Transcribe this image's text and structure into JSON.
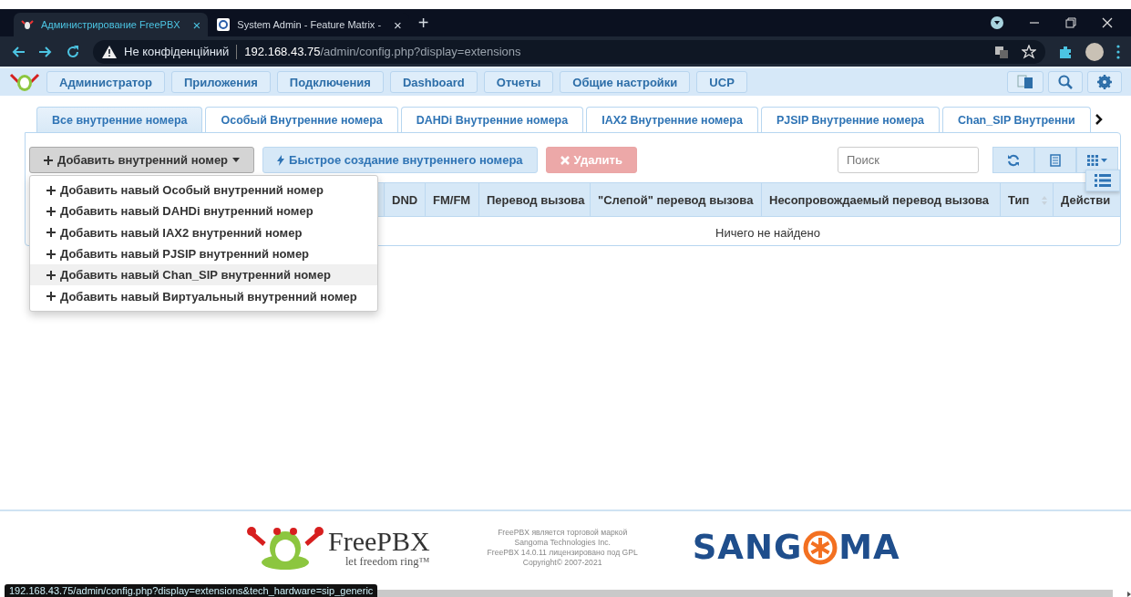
{
  "browser": {
    "tabs": [
      {
        "title": "Администрирование FreePBX",
        "selected": true,
        "close": "×"
      },
      {
        "title": "System Admin - Feature Matrix -",
        "selected": false,
        "close": "×"
      }
    ],
    "new_tab": "+",
    "address": {
      "warning": "Не конфіденційний",
      "host": "192.168.43.75",
      "path": "/admin/config.php?display=extensions"
    }
  },
  "nav": {
    "items": [
      {
        "label": "Администратор"
      },
      {
        "label": "Приложения"
      },
      {
        "label": "Подключения"
      },
      {
        "label": "Dashboard"
      },
      {
        "label": "Отчеты"
      },
      {
        "label": "Общие настройки"
      },
      {
        "label": "UCP"
      }
    ]
  },
  "extension_tabs": [
    {
      "label": "Все внутренние номера",
      "selected": true
    },
    {
      "label": "Особый Внутренние номера",
      "selected": false
    },
    {
      "label": "DAHDi Внутренние номера",
      "selected": false
    },
    {
      "label": "IAX2 Внутренние номера",
      "selected": false
    },
    {
      "label": "PJSIP Внутренние номера",
      "selected": false
    },
    {
      "label": "Chan_SIP Внутренни",
      "selected": false
    }
  ],
  "toolbar": {
    "add_button": "Добавить внутренний номер",
    "quick_button": "Быстрое создание внутреннего номера",
    "delete_button": {
      "label": "Удалить",
      "disabled": true
    },
    "search": {
      "placeholder": "Поиск"
    }
  },
  "table": {
    "columns": [
      "DND",
      "FM/FM",
      "Перевод вызова",
      "\"Слепой\" перевод вызова",
      "Несопровождаемый перевод вызова",
      "Тип",
      "Действи"
    ],
    "empty_message": "Ничего не найдено"
  },
  "add_menu": {
    "items": [
      {
        "label": "Добавить навый Особый внутренний номер",
        "selected": false
      },
      {
        "label": "Добавить навый DAHDi внутренний номер",
        "selected": false
      },
      {
        "label": "Добавить навый IAX2 внутренний номер",
        "selected": false
      },
      {
        "label": "Добавить навый PJSIP внутренний номер",
        "selected": false
      },
      {
        "label": "Добавить навый Chan_SIP внутренний номер",
        "selected": true
      },
      {
        "label": "Добавить навый Виртуальный внутренний номер",
        "selected": false
      }
    ]
  },
  "footer": {
    "logo_name": "FreePBX",
    "tagline": "let freedom ring™",
    "legal": [
      "FreePBX является торговой маркой",
      "Sangoma Technologies Inc.",
      "FreePBX 14.0.11 лицензировано под GPL",
      "Copyright© 2007-2021"
    ],
    "sangoma_left": "SANG",
    "sangoma_right": "MA"
  },
  "status_url": "192.168.43.75/admin/config.php?display=extensions&tech_hardware=sip_generic"
}
